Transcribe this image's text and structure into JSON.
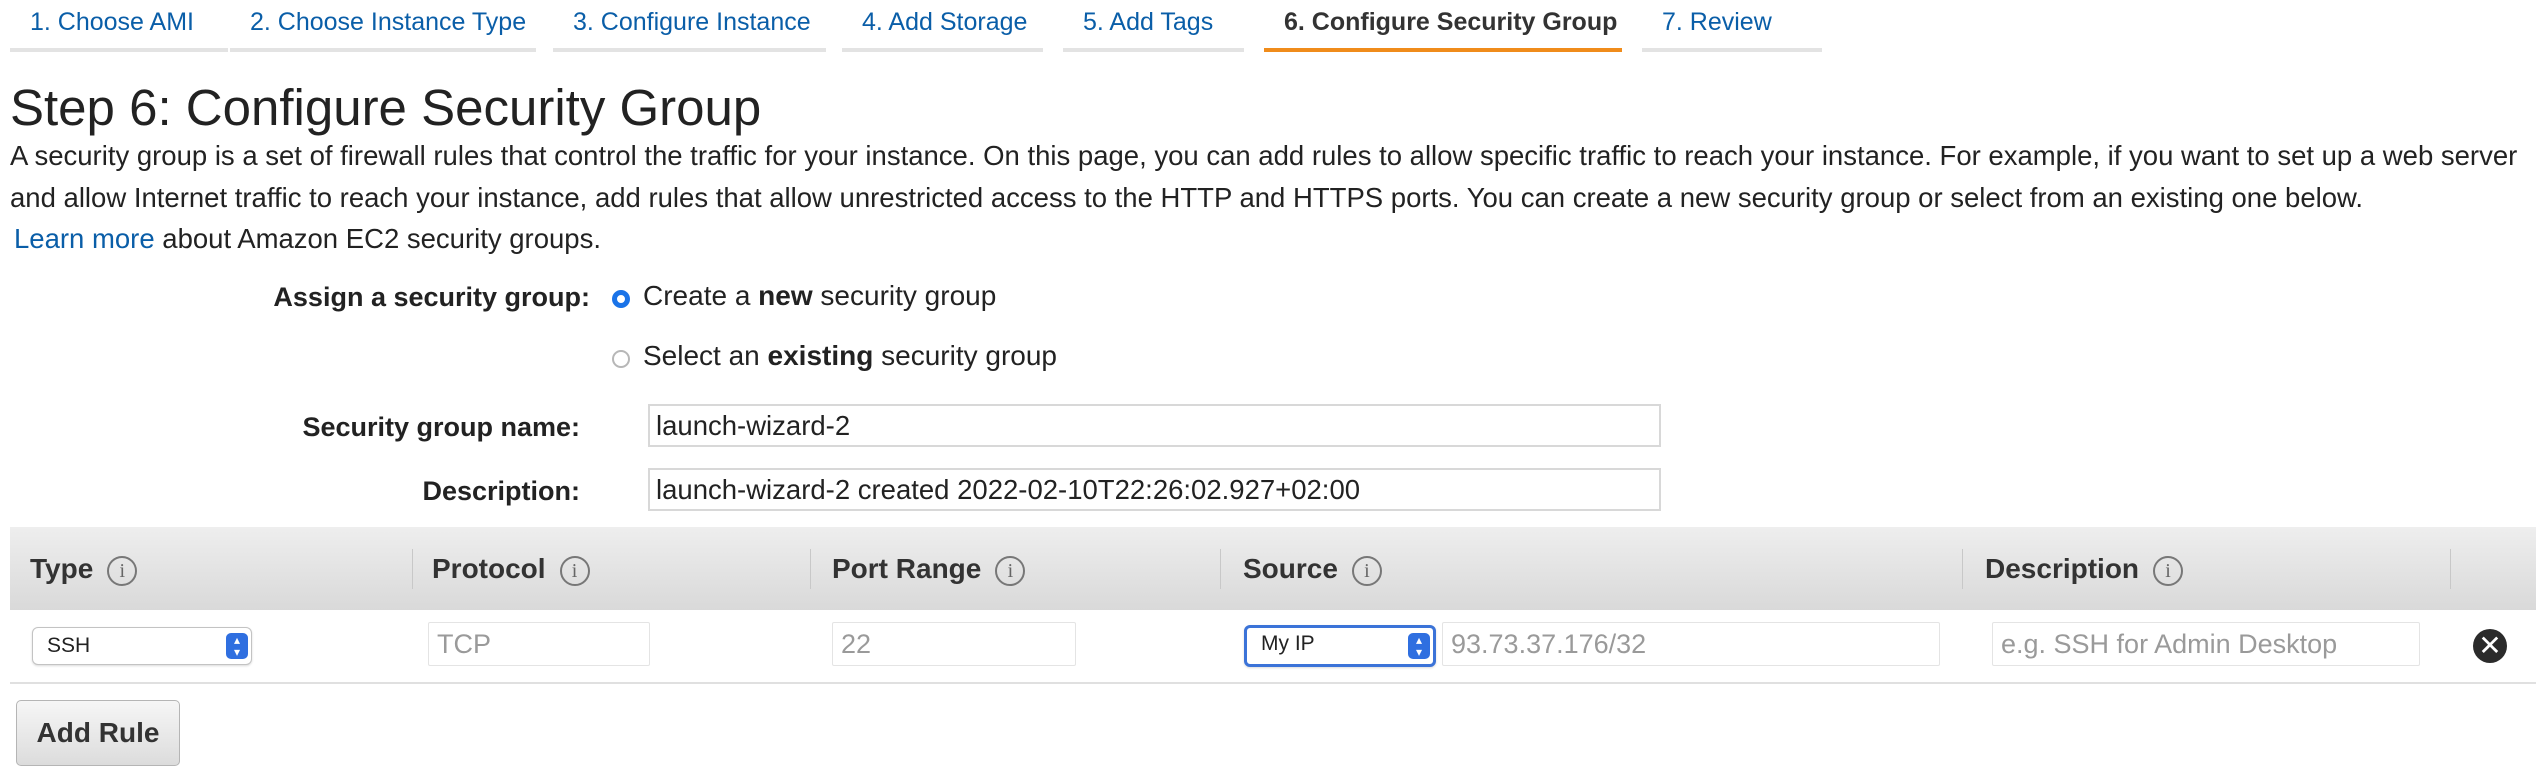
{
  "tabs": [
    {
      "label": "1. Choose AMI"
    },
    {
      "label": "2. Choose Instance Type"
    },
    {
      "label": "3. Configure Instance"
    },
    {
      "label": "4. Add Storage"
    },
    {
      "label": "5. Add Tags"
    },
    {
      "label": "6. Configure Security Group",
      "active": true
    },
    {
      "label": "7. Review"
    }
  ],
  "page": {
    "title": "Step 6: Configure Security Group",
    "description": "A security group is a set of firewall rules that control the traffic for your instance. On this page, you can add rules to allow specific traffic to reach your instance. For example, if you want to set up a web server and allow Internet traffic to reach your instance, add rules that allow unrestricted access to the HTTP and HTTPS ports. You can create a new security group or select from an existing one below.",
    "learn_more": "Learn more",
    "learn_more_suffix": " about Amazon EC2 security groups."
  },
  "assign": {
    "label": "Assign a security group:",
    "option_new_pre": "Create a ",
    "option_new_bold": "new",
    "option_new_post": " security group",
    "option_existing_pre": "Select an ",
    "option_existing_bold": "existing",
    "option_existing_post": " security group",
    "selected": "new"
  },
  "form": {
    "name_label": "Security group name:",
    "name_value": "launch-wizard-2",
    "desc_label": "Description:",
    "desc_value": "launch-wizard-2 created 2022-02-10T22:26:02.927+02:00"
  },
  "rules_table": {
    "headers": [
      "Type",
      "Protocol",
      "Port Range",
      "Source",
      "Description"
    ],
    "info_glyph": "i",
    "rows": [
      {
        "type": "SSH",
        "protocol": "TCP",
        "port_range": "22",
        "source_select": "My IP",
        "source_value": "93.73.37.176/32",
        "description_placeholder": "e.g. SSH for Admin Desktop"
      }
    ]
  },
  "actions": {
    "add_rule": "Add Rule",
    "remove_glyph": "✕"
  },
  "colors": {
    "link": "#0a5ea8",
    "active_tab_underline": "#f08c1b",
    "radio_selected": "#1a73e8",
    "select_spinner": "#2f6fe0"
  }
}
